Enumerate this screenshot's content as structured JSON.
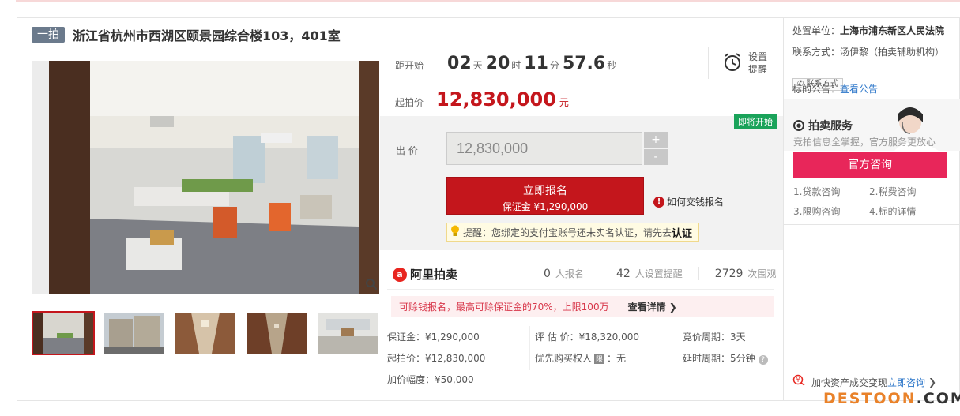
{
  "auction": {
    "tag": "一拍",
    "title": "浙江省杭州市西湖区颐景园综合楼103，401室"
  },
  "countdown": {
    "label": "距开始",
    "days": "02",
    "days_unit": "天",
    "hours": "20",
    "hours_unit": "时",
    "minutes": "11",
    "minutes_unit": "分",
    "seconds": "57.6",
    "seconds_unit": "秒",
    "remind_label": "设置提醒"
  },
  "start_price": {
    "label": "起拍价",
    "value": "12,830,000",
    "unit": "元"
  },
  "bid": {
    "badge": "即将开始",
    "label": "出  价",
    "value": "12,830,000",
    "plus": "+",
    "minus": "-",
    "signup_main": "立即报名",
    "signup_sub": "保证金 ¥1,290,000",
    "howpay": "如何交钱报名",
    "tip": "提醒：您绑定的支付宝账号还未实名认证，请先去",
    "tip_link": "认证"
  },
  "stats": {
    "logo": "阿里拍卖",
    "signups": "0",
    "signups_label": "人报名",
    "reminders": "42",
    "reminders_label": "人设置提醒",
    "views": "2729",
    "views_label": "次围观"
  },
  "promo": {
    "text": "可赊钱报名，最高可赊保证金的70%，上限100万",
    "link": "查看详情 ❯"
  },
  "details": {
    "deposit": "保证金：¥1,290,000",
    "appraisal": "评 估 价：¥18,320,000",
    "period": "竞价周期：3天",
    "start": "起拍价：¥12,830,000",
    "priority_pre": "优先购买权人",
    "priority_box": "限",
    "priority_post": "：无",
    "delay": "延时周期：5分钟",
    "increment": "加价幅度：¥50,000"
  },
  "right": {
    "court_label": "处置单位：",
    "court": "上海市浦东新区人民法院",
    "contact_label": "联系方式：汤伊黎（拍卖辅助机构）",
    "contact_btn": "联系方式",
    "notice_label": "标的公告：",
    "notice_link": "查看公告",
    "service_title": "拍卖服务",
    "service_sub": "竞拍信息全掌握，官方服务更放心",
    "consult_btn": "官方咨询",
    "links": [
      "1.贷款咨询",
      "2.税费咨询",
      "3.限购咨询",
      "4.标的详情"
    ],
    "fast_text": "加快资产成交变现",
    "fast_link": "立即咨询"
  },
  "watermark": {
    "text": "DESTOON",
    "suffix": ".COM"
  }
}
